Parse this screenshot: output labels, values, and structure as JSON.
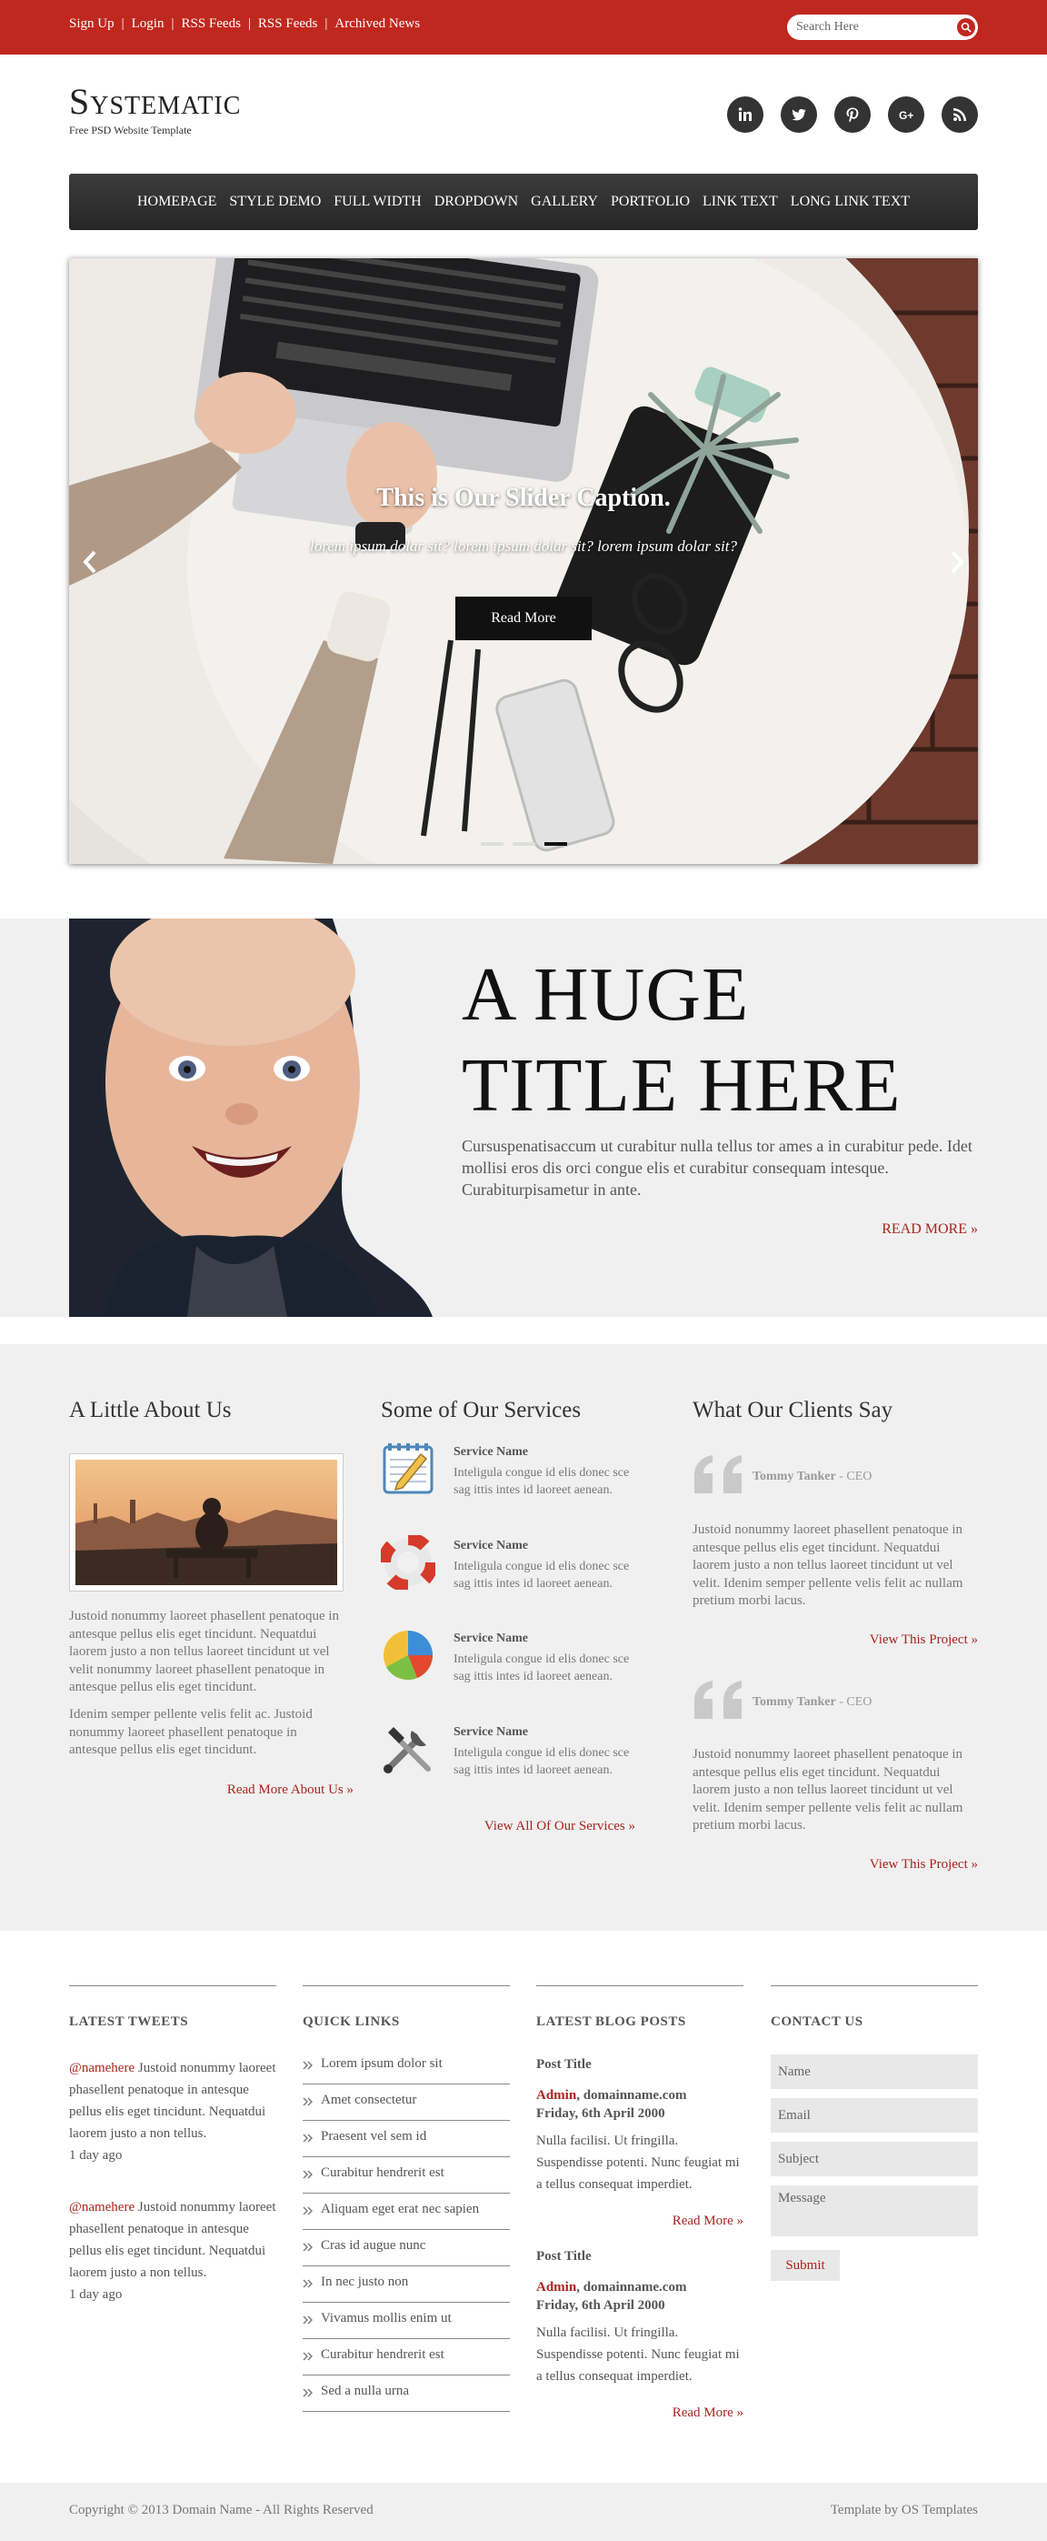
{
  "topbar": {
    "links": [
      "Sign Up",
      "Login",
      "RSS Feeds",
      "RSS Feeds",
      "Archived News"
    ],
    "search_placeholder": "Search Here",
    "accent": "#c0281f"
  },
  "header": {
    "logo": "Systematic",
    "tagline": "Free PSD Website Template",
    "social_icons": [
      "linkedin-icon",
      "twitter-icon",
      "pinterest-icon",
      "google-plus-icon",
      "rss-icon"
    ]
  },
  "nav": {
    "items": [
      "HOMEPAGE",
      "STYLE DEMO",
      "FULL WIDTH",
      "DROPDOWN",
      "GALLERY",
      "PORTFOLIO",
      "LINK TEXT",
      "LONG LINK TEXT"
    ]
  },
  "slider": {
    "caption": "This is Our Slider Caption.",
    "subcaption": "lorem ipsum dolar sit? lorem ipsum dolar sit? lorem ipsum dolar sit?",
    "button": "Read More",
    "slides": 3,
    "active_slide": 3
  },
  "hero": {
    "title_line1": "A HUGE",
    "title_line2": "TITLE HERE",
    "text": "Cursuspenatisaccum ut curabitur nulla tellus tor ames a in curabitur pede. Idet mollisi eros dis orci congue elis et curabitur consequam intesque. Curabiturpisametur in ante.",
    "read_more": "READ MORE »"
  },
  "about": {
    "heading": "A Little About Us",
    "para1": "Justoid nonummy laoreet phasellent penatoque in antesque pellus elis eget tincidunt. Nequatdui laorem justo a non tellus laoreet tincidunt ut vel velit nonummy laoreet phasellent penatoque in antesque pellus elis eget tincidunt.",
    "para2": "Idenim semper pellente velis felit ac. Justoid nonummy laoreet phasellent penatoque in antesque pellus elis eget tincidunt.",
    "link": "Read More About Us »"
  },
  "services": {
    "heading": "Some of Our Services",
    "items": [
      {
        "name": "Service Name",
        "text": "Inteligula congue id elis donec sce sag ittis intes id laoreet aenean.",
        "icon": "notepad-icon"
      },
      {
        "name": "Service Name",
        "text": "Inteligula congue id elis donec sce sag ittis intes id laoreet aenean.",
        "icon": "lifebuoy-icon"
      },
      {
        "name": "Service Name",
        "text": "Inteligula congue id elis donec sce sag ittis intes id laoreet aenean.",
        "icon": "pie-chart-icon"
      },
      {
        "name": "Service Name",
        "text": "Inteligula congue id elis donec sce sag ittis intes id laoreet aenean.",
        "icon": "tools-icon"
      }
    ],
    "link": "View All Of Our Services »"
  },
  "testimonials": {
    "heading": "What Our Clients Say",
    "items": [
      {
        "name": "Tommy Tanker",
        "role": " - CEO",
        "text": "Justoid nonummy laoreet phasellent penatoque in antesque pellus elis eget tincidunt. Nequatdui laorem justo a non tellus laoreet tincidunt ut vel velit. Idenim semper pellente velis felit ac nullam pretium morbi lacus.",
        "link": "View This Project »"
      },
      {
        "name": "Tommy Tanker",
        "role": " - CEO",
        "text": "Justoid nonummy laoreet phasellent penatoque in antesque pellus elis eget tincidunt. Nequatdui laorem justo a non tellus laoreet tincidunt ut vel velit. Idenim semper pellente velis felit ac nullam pretium morbi lacus.",
        "link": "View This Project »"
      }
    ]
  },
  "footer": {
    "tweets_heading": "LATEST TWEETS",
    "tweets": [
      {
        "handle": "@namehere",
        "text": " Justoid nonummy laoreet phasellent penatoque in antesque pellus elis eget tincidunt. Nequatdui laorem justo a non tellus.",
        "time": "1 day ago"
      },
      {
        "handle": "@namehere",
        "text": " Justoid nonummy laoreet phasellent penatoque in antesque pellus elis eget tincidunt. Nequatdui laorem justo a non tellus.",
        "time": "1 day ago"
      }
    ],
    "links_heading": "QUICK LINKS",
    "links": [
      "Lorem ipsum dolor sit",
      "Amet consectetur",
      "Praesent vel sem id",
      "Curabitur hendrerit est",
      "Aliquam eget erat nec sapien",
      "Cras id augue nunc",
      "In nec justo non",
      "Vivamus mollis enim ut",
      "Curabitur hendrerit est",
      "Sed a nulla urna"
    ],
    "blog_heading": "LATEST BLOG POSTS",
    "posts": [
      {
        "title": "Post Title",
        "author": "Admin",
        "domain": ", domainname.com",
        "date": "Friday, 6th April 2000",
        "text": "Nulla facilisi. Ut fringilla. Suspendisse potenti. Nunc feugiat mi a tellus consequat imperdiet.",
        "link": "Read More »"
      },
      {
        "title": "Post Title",
        "author": "Admin",
        "domain": ", domainname.com",
        "date": "Friday, 6th April 2000",
        "text": "Nulla facilisi. Ut fringilla. Suspendisse potenti. Nunc feugiat mi a tellus consequat imperdiet.",
        "link": "Read More »"
      }
    ],
    "contact_heading": "CONTACT US",
    "contact": {
      "name": "Name",
      "email": "Email",
      "subject": "Subject",
      "message": "Message",
      "submit": "Submit"
    },
    "copyright": "Copyright © 2013 Domain Name - All Rights Reserved",
    "credit": "Template by OS Templates"
  }
}
